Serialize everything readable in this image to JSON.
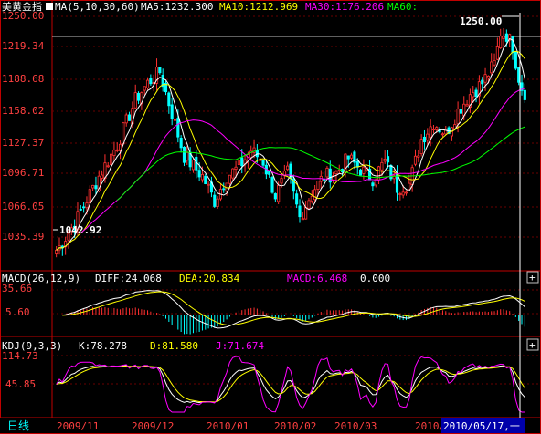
{
  "colors": {
    "background": "#000000",
    "border": "#c00000",
    "grid": "#6a0000",
    "candle_up": "#ff3030",
    "candle_down": "#00ffff",
    "ma5": "#ffffff",
    "ma10": "#ffff00",
    "ma30": "#ff00ff",
    "ma60": "#00ff00",
    "title": "#ffffff",
    "axis_text": "#ff4040",
    "highlight_bg": "#0000aa"
  },
  "price_panel": {
    "symbol": "美黄金指",
    "ma_label": "MA(5,10,30,60)",
    "ma5_label": "MA5:1232.300",
    "ma10_label": "MA10:1212.969",
    "ma30_label": "MA30:1176.206",
    "ma60_label": "MA60:",
    "high_label": "1250.00",
    "low_label": "1042.92",
    "y_ticks": [
      "1250.00",
      "1219.34",
      "1188.68",
      "1158.02",
      "1127.37",
      "1096.71",
      "1066.05",
      "1035.39"
    ]
  },
  "macd_panel": {
    "label": "MACD(26,12,9)",
    "diff_label": "DIFF:24.068",
    "dea_label": "DEA:20.834",
    "macd_label": "MACD:6.468",
    "zero_label": "0.000",
    "y_ticks": [
      "35.66",
      "5.60"
    ],
    "plus": "+"
  },
  "kdj_panel": {
    "label": "KDJ(9,3,3)",
    "k_label": "K:78.278",
    "d_label": "D:81.580",
    "j_label": "J:71.674",
    "y_ticks": [
      "114.73",
      "45.85"
    ],
    "plus": "+"
  },
  "x_axis": {
    "period_label": "日线",
    "months": [
      "2009/11",
      "2009/12",
      "2010/01",
      "2010/02",
      "2010/03",
      "2010/04"
    ],
    "cursor_date": "2010/05/17,一"
  },
  "chart_data": {
    "type": "candlestick",
    "y_range": [
      1030,
      1256
    ],
    "high": 1250.0,
    "low": 1042.92,
    "close_points": [
      {
        "i": 0,
        "v": 1045
      },
      {
        "i": 6,
        "v": 1070
      },
      {
        "i": 14,
        "v": 1112
      },
      {
        "i": 20,
        "v": 1140
      },
      {
        "i": 26,
        "v": 1180
      },
      {
        "i": 30,
        "v": 1195
      },
      {
        "i": 34,
        "v": 1205
      },
      {
        "i": 38,
        "v": 1168
      },
      {
        "i": 42,
        "v": 1130
      },
      {
        "i": 48,
        "v": 1112
      },
      {
        "i": 52,
        "v": 1090
      },
      {
        "i": 56,
        "v": 1112
      },
      {
        "i": 60,
        "v": 1120
      },
      {
        "i": 64,
        "v": 1135
      },
      {
        "i": 68,
        "v": 1125
      },
      {
        "i": 72,
        "v": 1095
      },
      {
        "i": 76,
        "v": 1115
      },
      {
        "i": 80,
        "v": 1075
      },
      {
        "i": 84,
        "v": 1098
      },
      {
        "i": 88,
        "v": 1112
      },
      {
        "i": 92,
        "v": 1115
      },
      {
        "i": 96,
        "v": 1128
      },
      {
        "i": 100,
        "v": 1118
      },
      {
        "i": 104,
        "v": 1110
      },
      {
        "i": 108,
        "v": 1125
      },
      {
        "i": 112,
        "v": 1102
      },
      {
        "i": 116,
        "v": 1105
      },
      {
        "i": 120,
        "v": 1145
      },
      {
        "i": 124,
        "v": 1160
      },
      {
        "i": 128,
        "v": 1150
      },
      {
        "i": 132,
        "v": 1170
      },
      {
        "i": 136,
        "v": 1185
      },
      {
        "i": 140,
        "v": 1195
      },
      {
        "i": 144,
        "v": 1212
      },
      {
        "i": 146,
        "v": 1240
      },
      {
        "i": 148,
        "v": 1238
      },
      {
        "i": 150,
        "v": 1228
      },
      {
        "i": 152,
        "v": 1200
      },
      {
        "i": 154,
        "v": 1182
      }
    ],
    "count": 155
  }
}
